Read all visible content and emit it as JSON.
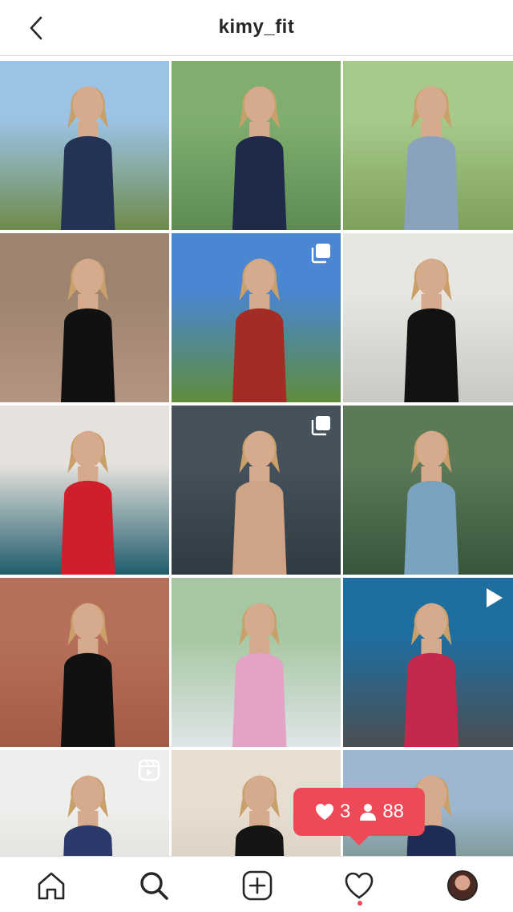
{
  "header": {
    "username": "kimy_fit",
    "back_icon": "chevron-left-icon"
  },
  "grid": {
    "posts": [
      {
        "type": "photo",
        "bg": "#6f8a4a",
        "top": "#9bc3e6",
        "figure": "#233255"
      },
      {
        "type": "photo",
        "bg": "#5d8b53",
        "top": "#7fae6f",
        "figure": "#1f2a4a"
      },
      {
        "type": "photo",
        "bg": "#7fa05c",
        "top": "#a7c98a",
        "figure": "#8aa2be"
      },
      {
        "type": "photo",
        "bg": "#b49480",
        "top": "#9e8470",
        "figure": "#111111"
      },
      {
        "type": "carousel",
        "bg": "#5f8d3c",
        "top": "#4a86d1",
        "figure": "#a32c25"
      },
      {
        "type": "photo",
        "bg": "#c9c8c4",
        "top": "#e8e6e1",
        "figure": "#121212"
      },
      {
        "type": "photo",
        "bg": "#1f5c6c",
        "top": "#e5e2dd",
        "figure": "#cf1f2d"
      },
      {
        "type": "carousel",
        "bg": "#2f3a42",
        "top": "#46525b",
        "figure": "#cfa486"
      },
      {
        "type": "photo",
        "bg": "#36553a",
        "top": "#5c7a58",
        "figure": "#7aa3c0"
      },
      {
        "type": "photo",
        "bg": "#a55a45",
        "top": "#b6705a",
        "figure": "#111111"
      },
      {
        "type": "photo",
        "bg": "#dfe5e8",
        "top": "#a7c7a2",
        "figure": "#e2a3c6"
      },
      {
        "type": "video",
        "bg": "#4b4f52",
        "top": "#1e6ea0",
        "figure": "#c3284d"
      },
      {
        "type": "reel",
        "bg": "#d8d6d2",
        "top": "#eeeeec",
        "figure": "#2b3a6a"
      },
      {
        "type": "photo",
        "bg": "#cfc5b8",
        "top": "#e7ddd0",
        "figure": "#151515"
      },
      {
        "type": "photo",
        "bg": "#5a7550",
        "top": "#9db7d0",
        "figure": "#1e2b55"
      }
    ]
  },
  "notification": {
    "likes": "3",
    "followers": "88",
    "color": "#ed4956"
  },
  "nav": {
    "items": [
      "home-icon",
      "search-icon",
      "new-post-icon",
      "activity-icon",
      "profile-avatar"
    ],
    "active": "search-icon",
    "dot_color": "#ed4956"
  }
}
